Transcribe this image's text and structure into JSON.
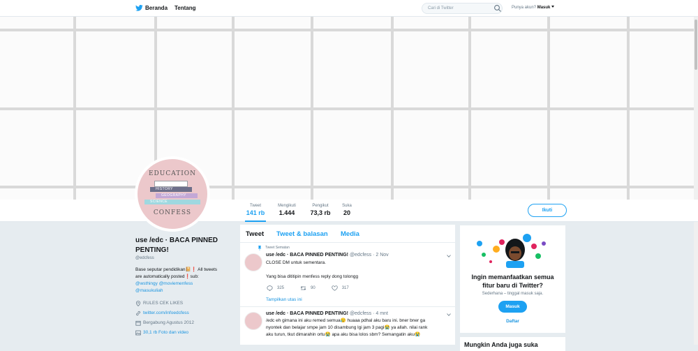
{
  "topnav": {
    "home_label": "Beranda",
    "about_label": "Tentang",
    "search_placeholder": "Cari di Twitter",
    "account_question": "Punya akun?",
    "login_label": "Masuk"
  },
  "stats": [
    {
      "label": "Tweet",
      "value": "141 rb"
    },
    {
      "label": "Mengikuti",
      "value": "1.444"
    },
    {
      "label": "Pengikut",
      "value": "73,3 rb"
    },
    {
      "label": "Suka",
      "value": "20"
    }
  ],
  "follow_label": "Ikuti",
  "avatar": {
    "top_text": "EDUCATION",
    "bottom_text": "CONFESS",
    "books": [
      "HISTORY",
      "GEOGRAPHY",
      "SCIENCE"
    ]
  },
  "profile": {
    "name": "use /edc · BACA PINNED PENTING!",
    "handle": "@edcfess",
    "bio_line1": "Base seputar pendidikan📔❗ All tweets",
    "bio_line2": "are automatically posted❗sub:",
    "bio_link1": "@wsthingy @moviemenfess",
    "bio_link2": "@masukuliah",
    "location": "RULES CEK LIKES",
    "website": "twitter.com/infoedcfess",
    "joined": "Bergabung Agustus 2012",
    "media": "30,1 rb Foto dan video"
  },
  "tabs": {
    "tweets": "Tweet",
    "replies": "Tweet & balasan",
    "media": "Media"
  },
  "tweets": [
    {
      "pinned_label": "Tweet Sematan",
      "name": "use /edc · BACA PINNED PENTING!",
      "meta": "@edcfess · 2 Nov",
      "line1": "CLOSE DM untuk sementara.",
      "line2": "Yang bisa dititipin menfess reply dong tolongg",
      "replies": "325",
      "retweets": "90",
      "likes": "317",
      "thread_label": "Tampilkan utas ini"
    },
    {
      "name": "use /edc · BACA PINNED PENTING!",
      "meta": "@edcfess · 4 mnt",
      "line1": "/edc eh gimana ini aku remed semua😥 huaaa pdhal aku baru ini. bner bner ga",
      "line2": "nyontek dan belajar smpe jam 10 disambung lgi jam 3 pagi😭 ya allah. nilai rank",
      "line3": "aku turun, tkut dimarahin ortu😭 apa aku bisa lolos sbm? Semangatin aku😭"
    }
  ],
  "sidebar": {
    "title_line1": "Ingin memanfaatkan semua",
    "title_line2": "fitur baru di Twitter?",
    "subtitle": "Sederhana – tinggal masuk saja.",
    "login_label": "Masuk",
    "signup_label": "Daftar",
    "card2_title": "Mungkin Anda juga suka"
  },
  "colors": {
    "accent": "#1da1f2",
    "link": "#1b95e0",
    "avatar_bg": "#ecc8cb"
  }
}
